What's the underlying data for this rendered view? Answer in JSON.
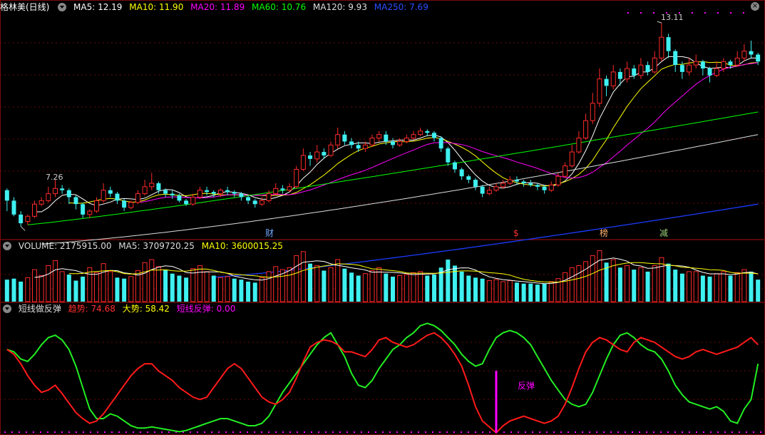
{
  "main_panel": {
    "title": "格林美(日线)",
    "ma": [
      {
        "label": "MA5: 12.19",
        "color": "#ffffff"
      },
      {
        "label": "MA10: 11.90",
        "color": "#ffff00"
      },
      {
        "label": "MA20: 11.89",
        "color": "#ff00ff"
      },
      {
        "label": "MA60: 10.76",
        "color": "#00ff00"
      },
      {
        "label": "MA120: 9.93",
        "color": "#dddddd"
      },
      {
        "label": "MA250: 7.69",
        "color": "#0000ff"
      }
    ],
    "high_label": "13.11",
    "low_label": "7.26",
    "events": [
      {
        "text": "财",
        "color": "#6fa8ff"
      },
      {
        "text": "$",
        "color": "#ff3030"
      },
      {
        "text": "榜",
        "color": "#ffb070"
      },
      {
        "text": "减",
        "color": "#9ad07a"
      }
    ]
  },
  "volume_panel": {
    "labels": [
      {
        "label": "VOLUME: 2175915.00",
        "color": "#dddddd"
      },
      {
        "label": "MA5: 3709720.25",
        "color": "#dddddd"
      },
      {
        "label": "MA10: 3600015.25",
        "color": "#ffff00"
      }
    ]
  },
  "indicator_panel": {
    "labels": [
      {
        "label": "短线做反弹",
        "color": "#dddddd"
      },
      {
        "label": "趋势: 74.68",
        "color": "#ff3030"
      },
      {
        "label": "大势: 58.42",
        "color": "#ffff00"
      },
      {
        "label": "短线反弹: 0.00",
        "color": "#ff00ff"
      }
    ],
    "signal_label": "反弹"
  },
  "chart_data": {
    "type": "candlestick",
    "price_range": [
      6.9,
      13.4
    ],
    "candles": [
      [
        8.3,
        8.0,
        8.35,
        7.7
      ],
      [
        8.0,
        7.6,
        8.1,
        7.55
      ],
      [
        7.6,
        7.35,
        7.7,
        7.26
      ],
      [
        7.4,
        7.55,
        7.6,
        7.3
      ],
      [
        7.55,
        7.9,
        8.0,
        7.5
      ],
      [
        7.9,
        8.0,
        8.1,
        7.85
      ],
      [
        8.0,
        8.2,
        8.4,
        7.95
      ],
      [
        8.2,
        8.35,
        8.6,
        8.1
      ],
      [
        8.35,
        8.3,
        8.45,
        8.2
      ],
      [
        8.3,
        8.1,
        8.35,
        7.9
      ],
      [
        8.1,
        7.9,
        8.15,
        7.75
      ],
      [
        7.9,
        7.6,
        7.95,
        7.5
      ],
      [
        7.6,
        7.7,
        7.75,
        7.5
      ],
      [
        7.7,
        8.0,
        8.1,
        7.65
      ],
      [
        8.0,
        8.3,
        8.5,
        7.95
      ],
      [
        8.3,
        8.2,
        8.4,
        8.1
      ],
      [
        8.2,
        8.0,
        8.25,
        7.9
      ],
      [
        8.0,
        7.8,
        8.05,
        7.7
      ],
      [
        7.8,
        7.95,
        8.0,
        7.75
      ],
      [
        7.95,
        8.2,
        8.3,
        7.9
      ],
      [
        8.2,
        8.4,
        8.6,
        8.15
      ],
      [
        8.4,
        8.5,
        8.8,
        8.3
      ],
      [
        8.5,
        8.3,
        8.55,
        8.2
      ],
      [
        8.3,
        8.2,
        8.35,
        8.1
      ],
      [
        8.2,
        8.15,
        8.3,
        8.05
      ],
      [
        8.15,
        8.0,
        8.2,
        7.95
      ],
      [
        8.0,
        7.9,
        8.05,
        7.85
      ],
      [
        7.9,
        8.1,
        8.2,
        7.85
      ],
      [
        8.1,
        8.3,
        8.4,
        8.05
      ],
      [
        8.3,
        8.25,
        8.4,
        8.15
      ],
      [
        8.25,
        8.2,
        8.3,
        8.1
      ],
      [
        8.2,
        8.3,
        8.35,
        8.1
      ],
      [
        8.3,
        8.25,
        8.4,
        8.15
      ],
      [
        8.25,
        8.2,
        8.3,
        8.1
      ],
      [
        8.2,
        8.1,
        8.25,
        8.0
      ],
      [
        8.1,
        8.0,
        8.15,
        7.9
      ],
      [
        8.0,
        7.9,
        8.05,
        7.8
      ],
      [
        7.9,
        8.0,
        8.1,
        7.85
      ],
      [
        8.0,
        8.2,
        8.3,
        7.95
      ],
      [
        8.2,
        8.35,
        8.5,
        8.15
      ],
      [
        8.35,
        8.3,
        8.45,
        8.2
      ],
      [
        8.3,
        8.4,
        8.5,
        8.25
      ],
      [
        8.4,
        8.9,
        9.0,
        8.35
      ],
      [
        8.9,
        9.3,
        9.5,
        8.85
      ],
      [
        9.3,
        9.2,
        9.4,
        9.0
      ],
      [
        9.2,
        9.4,
        9.6,
        9.1
      ],
      [
        9.4,
        9.3,
        9.5,
        9.2
      ],
      [
        9.3,
        9.6,
        9.7,
        9.25
      ],
      [
        9.6,
        9.9,
        10.1,
        9.5
      ],
      [
        9.9,
        9.7,
        10.0,
        9.6
      ],
      [
        9.7,
        9.6,
        9.8,
        9.5
      ],
      [
        9.6,
        9.5,
        9.7,
        9.4
      ],
      [
        9.5,
        9.6,
        9.7,
        9.4
      ],
      [
        9.6,
        9.8,
        9.9,
        9.55
      ],
      [
        9.8,
        9.9,
        10.0,
        9.7
      ],
      [
        9.9,
        9.7,
        10.0,
        9.6
      ],
      [
        9.7,
        9.6,
        9.8,
        9.5
      ],
      [
        9.6,
        9.7,
        9.8,
        9.55
      ],
      [
        9.7,
        9.8,
        9.9,
        9.65
      ],
      [
        9.8,
        9.9,
        10.0,
        9.75
      ],
      [
        9.9,
        10.0,
        10.1,
        9.85
      ],
      [
        10.0,
        9.95,
        10.05,
        9.85
      ],
      [
        9.95,
        9.8,
        10.0,
        9.7
      ],
      [
        9.8,
        9.5,
        9.85,
        9.4
      ],
      [
        9.5,
        9.1,
        9.55,
        9.0
      ],
      [
        9.1,
        8.9,
        9.15,
        8.8
      ],
      [
        8.9,
        8.7,
        8.95,
        8.6
      ],
      [
        8.7,
        8.6,
        8.75,
        8.5
      ],
      [
        8.6,
        8.4,
        8.65,
        8.3
      ],
      [
        8.4,
        8.2,
        8.45,
        8.1
      ],
      [
        8.2,
        8.3,
        8.4,
        8.15
      ],
      [
        8.3,
        8.4,
        8.5,
        8.25
      ],
      [
        8.4,
        8.5,
        8.6,
        8.35
      ],
      [
        8.5,
        8.6,
        8.7,
        8.45
      ],
      [
        8.6,
        8.55,
        8.7,
        8.45
      ],
      [
        8.55,
        8.5,
        8.6,
        8.4
      ],
      [
        8.5,
        8.45,
        8.6,
        8.4
      ],
      [
        8.45,
        8.4,
        8.5,
        8.3
      ],
      [
        8.4,
        8.3,
        8.45,
        8.2
      ],
      [
        8.3,
        8.45,
        8.55,
        8.25
      ],
      [
        8.45,
        8.7,
        8.8,
        8.4
      ],
      [
        8.7,
        9.0,
        9.1,
        8.65
      ],
      [
        9.0,
        9.4,
        9.6,
        8.95
      ],
      [
        9.4,
        9.8,
        10.0,
        9.35
      ],
      [
        9.8,
        10.3,
        10.5,
        9.75
      ],
      [
        10.3,
        10.8,
        11.1,
        10.2
      ],
      [
        10.8,
        11.5,
        11.8,
        10.7
      ],
      [
        11.5,
        11.3,
        11.6,
        11.0
      ],
      [
        11.3,
        11.7,
        11.9,
        11.2
      ],
      [
        11.7,
        11.5,
        11.8,
        11.3
      ],
      [
        11.5,
        11.8,
        12.0,
        11.4
      ],
      [
        11.8,
        11.6,
        11.9,
        11.5
      ],
      [
        11.6,
        11.9,
        12.1,
        11.5
      ],
      [
        11.9,
        11.7,
        12.0,
        11.6
      ],
      [
        11.7,
        12.1,
        12.3,
        11.65
      ],
      [
        12.1,
        12.7,
        13.11,
        12.0
      ],
      [
        12.7,
        12.3,
        12.8,
        12.1
      ],
      [
        12.3,
        11.9,
        12.35,
        11.7
      ],
      [
        11.9,
        11.7,
        12.0,
        11.5
      ],
      [
        11.7,
        11.9,
        12.1,
        11.6
      ],
      [
        11.9,
        12.0,
        12.2,
        11.8
      ],
      [
        12.0,
        11.8,
        12.05,
        11.6
      ],
      [
        11.8,
        11.6,
        11.85,
        11.4
      ],
      [
        11.6,
        11.8,
        12.0,
        11.55
      ],
      [
        11.8,
        12.0,
        12.1,
        11.7
      ],
      [
        12.0,
        11.9,
        12.05,
        11.8
      ],
      [
        11.9,
        12.1,
        12.3,
        11.85
      ],
      [
        12.1,
        12.3,
        12.5,
        12.0
      ],
      [
        12.3,
        12.2,
        12.6,
        12.1
      ],
      [
        12.2,
        12.0,
        12.25,
        11.9
      ]
    ],
    "volume_range": [
      0,
      5200000
    ],
    "volumes": [
      [
        2.2,
        0
      ],
      [
        2.3,
        0
      ],
      [
        2.0,
        0
      ],
      [
        2.4,
        1
      ],
      [
        3.2,
        1
      ],
      [
        2.6,
        1
      ],
      [
        3.6,
        1
      ],
      [
        4.1,
        1
      ],
      [
        3.0,
        1
      ],
      [
        2.7,
        0
      ],
      [
        2.1,
        0
      ],
      [
        2.5,
        0
      ],
      [
        3.4,
        1
      ],
      [
        2.9,
        1
      ],
      [
        3.8,
        1
      ],
      [
        3.0,
        1
      ],
      [
        2.4,
        0
      ],
      [
        2.3,
        0
      ],
      [
        2.5,
        1
      ],
      [
        3.1,
        1
      ],
      [
        3.9,
        1
      ],
      [
        4.2,
        1
      ],
      [
        3.5,
        1
      ],
      [
        3.2,
        0
      ],
      [
        2.8,
        0
      ],
      [
        2.6,
        0
      ],
      [
        2.4,
        0
      ],
      [
        3.3,
        1
      ],
      [
        3.6,
        1
      ],
      [
        3.0,
        1
      ],
      [
        2.6,
        0
      ],
      [
        2.4,
        1
      ],
      [
        2.5,
        1
      ],
      [
        2.3,
        0
      ],
      [
        2.2,
        0
      ],
      [
        2.0,
        0
      ],
      [
        1.9,
        0
      ],
      [
        2.4,
        1
      ],
      [
        3.0,
        1
      ],
      [
        3.5,
        1
      ],
      [
        3.2,
        1
      ],
      [
        3.4,
        1
      ],
      [
        4.6,
        1
      ],
      [
        5.0,
        1
      ],
      [
        3.8,
        0
      ],
      [
        3.6,
        1
      ],
      [
        3.1,
        0
      ],
      [
        3.4,
        1
      ],
      [
        4.2,
        1
      ],
      [
        3.3,
        0
      ],
      [
        2.9,
        0
      ],
      [
        2.6,
        0
      ],
      [
        2.8,
        1
      ],
      [
        3.1,
        1
      ],
      [
        3.4,
        1
      ],
      [
        2.8,
        0
      ],
      [
        2.5,
        0
      ],
      [
        2.6,
        1
      ],
      [
        2.7,
        1
      ],
      [
        2.9,
        1
      ],
      [
        3.0,
        1
      ],
      [
        2.6,
        0
      ],
      [
        2.7,
        0
      ],
      [
        3.4,
        0
      ],
      [
        4.2,
        0
      ],
      [
        3.6,
        0
      ],
      [
        3.0,
        0
      ],
      [
        2.6,
        0
      ],
      [
        2.4,
        0
      ],
      [
        2.3,
        0
      ],
      [
        2.1,
        1
      ],
      [
        2.2,
        1
      ],
      [
        2.0,
        1
      ],
      [
        2.1,
        1
      ],
      [
        1.9,
        0
      ],
      [
        1.8,
        0
      ],
      [
        1.8,
        0
      ],
      [
        1.7,
        0
      ],
      [
        1.8,
        0
      ],
      [
        2.0,
        1
      ],
      [
        2.3,
        1
      ],
      [
        2.9,
        1
      ],
      [
        3.4,
        1
      ],
      [
        3.6,
        1
      ],
      [
        4.0,
        1
      ],
      [
        4.6,
        1
      ],
      [
        5.1,
        1
      ],
      [
        3.9,
        0
      ],
      [
        4.2,
        1
      ],
      [
        3.4,
        0
      ],
      [
        3.6,
        1
      ],
      [
        3.2,
        0
      ],
      [
        3.4,
        1
      ],
      [
        3.0,
        0
      ],
      [
        3.6,
        1
      ],
      [
        4.4,
        1
      ],
      [
        3.8,
        0
      ],
      [
        3.2,
        0
      ],
      [
        2.8,
        0
      ],
      [
        3.0,
        1
      ],
      [
        3.0,
        1
      ],
      [
        2.6,
        0
      ],
      [
        2.5,
        0
      ],
      [
        2.8,
        1
      ],
      [
        3.0,
        1
      ],
      [
        2.6,
        0
      ],
      [
        2.9,
        1
      ],
      [
        3.2,
        1
      ],
      [
        3.0,
        0
      ],
      [
        2.2,
        0
      ]
    ],
    "indicator_range": [
      0,
      100
    ],
    "trend": [
      70,
      66,
      58,
      48,
      40,
      34,
      36,
      40,
      33,
      25,
      17,
      12,
      8,
      10,
      16,
      24,
      32,
      40,
      48,
      54,
      58,
      58,
      52,
      48,
      44,
      38,
      34,
      30,
      28,
      30,
      38,
      46,
      54,
      58,
      54,
      46,
      38,
      30,
      26,
      24,
      28,
      34,
      46,
      60,
      72,
      76,
      78,
      77,
      74,
      68,
      68,
      66,
      64,
      70,
      78,
      80,
      76,
      74,
      72,
      74,
      78,
      82,
      84,
      80,
      74,
      66,
      56,
      40,
      22,
      10,
      5,
      0,
      6,
      10,
      12,
      14,
      12,
      10,
      8,
      10,
      14,
      24,
      38,
      54,
      68,
      76,
      80,
      78,
      74,
      70,
      68,
      76,
      80,
      78,
      76,
      72,
      68,
      64,
      62,
      64,
      68,
      70,
      68,
      66,
      68,
      70,
      72,
      76,
      80,
      74
    ],
    "momentum": [
      70,
      68,
      62,
      60,
      66,
      74,
      80,
      82,
      78,
      70,
      56,
      38,
      20,
      12,
      12,
      16,
      14,
      10,
      6,
      4,
      4,
      5,
      4,
      3,
      2,
      1,
      2,
      4,
      6,
      8,
      10,
      12,
      12,
      10,
      8,
      6,
      6,
      8,
      14,
      24,
      34,
      42,
      50,
      58,
      66,
      74,
      80,
      84,
      74,
      64,
      50,
      40,
      38,
      44,
      54,
      62,
      70,
      74,
      80,
      84,
      90,
      92,
      90,
      86,
      80,
      74,
      66,
      60,
      56,
      58,
      70,
      80,
      84,
      86,
      84,
      80,
      74,
      64,
      54,
      44,
      36,
      28,
      24,
      22,
      24,
      34,
      48,
      62,
      74,
      82,
      84,
      80,
      74,
      70,
      68,
      62,
      52,
      40,
      32,
      26,
      24,
      22,
      20,
      22,
      18,
      10,
      8,
      20,
      28,
      58
    ]
  }
}
